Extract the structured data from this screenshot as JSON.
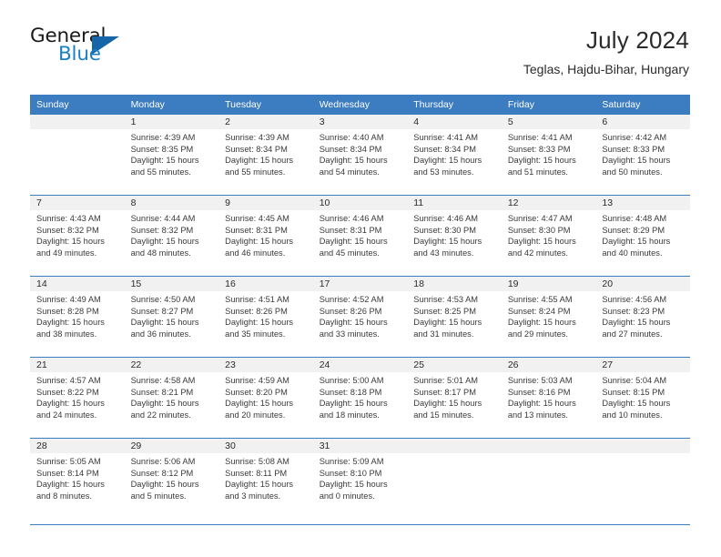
{
  "brand": {
    "name_part1": "General",
    "name_part2": "Blue",
    "accent_color": "#1c7fc4",
    "triangle_color": "#1565a8"
  },
  "header": {
    "title": "July 2024",
    "location": "Teglas, Hajdu-Bihar, Hungary"
  },
  "theme": {
    "header_bar_color": "#3c7cc0",
    "daynum_strip_color": "#f1f1f1",
    "text_color": "#3a3a3a"
  },
  "weekdays": [
    "Sunday",
    "Monday",
    "Tuesday",
    "Wednesday",
    "Thursday",
    "Friday",
    "Saturday"
  ],
  "weeks": [
    [
      {
        "day": "",
        "sunrise": "",
        "sunset": "",
        "daylight_1": "",
        "daylight_2": ""
      },
      {
        "day": "1",
        "sunrise": "Sunrise: 4:39 AM",
        "sunset": "Sunset: 8:35 PM",
        "daylight_1": "Daylight: 15 hours",
        "daylight_2": "and 55 minutes."
      },
      {
        "day": "2",
        "sunrise": "Sunrise: 4:39 AM",
        "sunset": "Sunset: 8:34 PM",
        "daylight_1": "Daylight: 15 hours",
        "daylight_2": "and 55 minutes."
      },
      {
        "day": "3",
        "sunrise": "Sunrise: 4:40 AM",
        "sunset": "Sunset: 8:34 PM",
        "daylight_1": "Daylight: 15 hours",
        "daylight_2": "and 54 minutes."
      },
      {
        "day": "4",
        "sunrise": "Sunrise: 4:41 AM",
        "sunset": "Sunset: 8:34 PM",
        "daylight_1": "Daylight: 15 hours",
        "daylight_2": "and 53 minutes."
      },
      {
        "day": "5",
        "sunrise": "Sunrise: 4:41 AM",
        "sunset": "Sunset: 8:33 PM",
        "daylight_1": "Daylight: 15 hours",
        "daylight_2": "and 51 minutes."
      },
      {
        "day": "6",
        "sunrise": "Sunrise: 4:42 AM",
        "sunset": "Sunset: 8:33 PM",
        "daylight_1": "Daylight: 15 hours",
        "daylight_2": "and 50 minutes."
      }
    ],
    [
      {
        "day": "7",
        "sunrise": "Sunrise: 4:43 AM",
        "sunset": "Sunset: 8:32 PM",
        "daylight_1": "Daylight: 15 hours",
        "daylight_2": "and 49 minutes."
      },
      {
        "day": "8",
        "sunrise": "Sunrise: 4:44 AM",
        "sunset": "Sunset: 8:32 PM",
        "daylight_1": "Daylight: 15 hours",
        "daylight_2": "and 48 minutes."
      },
      {
        "day": "9",
        "sunrise": "Sunrise: 4:45 AM",
        "sunset": "Sunset: 8:31 PM",
        "daylight_1": "Daylight: 15 hours",
        "daylight_2": "and 46 minutes."
      },
      {
        "day": "10",
        "sunrise": "Sunrise: 4:46 AM",
        "sunset": "Sunset: 8:31 PM",
        "daylight_1": "Daylight: 15 hours",
        "daylight_2": "and 45 minutes."
      },
      {
        "day": "11",
        "sunrise": "Sunrise: 4:46 AM",
        "sunset": "Sunset: 8:30 PM",
        "daylight_1": "Daylight: 15 hours",
        "daylight_2": "and 43 minutes."
      },
      {
        "day": "12",
        "sunrise": "Sunrise: 4:47 AM",
        "sunset": "Sunset: 8:30 PM",
        "daylight_1": "Daylight: 15 hours",
        "daylight_2": "and 42 minutes."
      },
      {
        "day": "13",
        "sunrise": "Sunrise: 4:48 AM",
        "sunset": "Sunset: 8:29 PM",
        "daylight_1": "Daylight: 15 hours",
        "daylight_2": "and 40 minutes."
      }
    ],
    [
      {
        "day": "14",
        "sunrise": "Sunrise: 4:49 AM",
        "sunset": "Sunset: 8:28 PM",
        "daylight_1": "Daylight: 15 hours",
        "daylight_2": "and 38 minutes."
      },
      {
        "day": "15",
        "sunrise": "Sunrise: 4:50 AM",
        "sunset": "Sunset: 8:27 PM",
        "daylight_1": "Daylight: 15 hours",
        "daylight_2": "and 36 minutes."
      },
      {
        "day": "16",
        "sunrise": "Sunrise: 4:51 AM",
        "sunset": "Sunset: 8:26 PM",
        "daylight_1": "Daylight: 15 hours",
        "daylight_2": "and 35 minutes."
      },
      {
        "day": "17",
        "sunrise": "Sunrise: 4:52 AM",
        "sunset": "Sunset: 8:26 PM",
        "daylight_1": "Daylight: 15 hours",
        "daylight_2": "and 33 minutes."
      },
      {
        "day": "18",
        "sunrise": "Sunrise: 4:53 AM",
        "sunset": "Sunset: 8:25 PM",
        "daylight_1": "Daylight: 15 hours",
        "daylight_2": "and 31 minutes."
      },
      {
        "day": "19",
        "sunrise": "Sunrise: 4:55 AM",
        "sunset": "Sunset: 8:24 PM",
        "daylight_1": "Daylight: 15 hours",
        "daylight_2": "and 29 minutes."
      },
      {
        "day": "20",
        "sunrise": "Sunrise: 4:56 AM",
        "sunset": "Sunset: 8:23 PM",
        "daylight_1": "Daylight: 15 hours",
        "daylight_2": "and 27 minutes."
      }
    ],
    [
      {
        "day": "21",
        "sunrise": "Sunrise: 4:57 AM",
        "sunset": "Sunset: 8:22 PM",
        "daylight_1": "Daylight: 15 hours",
        "daylight_2": "and 24 minutes."
      },
      {
        "day": "22",
        "sunrise": "Sunrise: 4:58 AM",
        "sunset": "Sunset: 8:21 PM",
        "daylight_1": "Daylight: 15 hours",
        "daylight_2": "and 22 minutes."
      },
      {
        "day": "23",
        "sunrise": "Sunrise: 4:59 AM",
        "sunset": "Sunset: 8:20 PM",
        "daylight_1": "Daylight: 15 hours",
        "daylight_2": "and 20 minutes."
      },
      {
        "day": "24",
        "sunrise": "Sunrise: 5:00 AM",
        "sunset": "Sunset: 8:18 PM",
        "daylight_1": "Daylight: 15 hours",
        "daylight_2": "and 18 minutes."
      },
      {
        "day": "25",
        "sunrise": "Sunrise: 5:01 AM",
        "sunset": "Sunset: 8:17 PM",
        "daylight_1": "Daylight: 15 hours",
        "daylight_2": "and 15 minutes."
      },
      {
        "day": "26",
        "sunrise": "Sunrise: 5:03 AM",
        "sunset": "Sunset: 8:16 PM",
        "daylight_1": "Daylight: 15 hours",
        "daylight_2": "and 13 minutes."
      },
      {
        "day": "27",
        "sunrise": "Sunrise: 5:04 AM",
        "sunset": "Sunset: 8:15 PM",
        "daylight_1": "Daylight: 15 hours",
        "daylight_2": "and 10 minutes."
      }
    ],
    [
      {
        "day": "28",
        "sunrise": "Sunrise: 5:05 AM",
        "sunset": "Sunset: 8:14 PM",
        "daylight_1": "Daylight: 15 hours",
        "daylight_2": "and 8 minutes."
      },
      {
        "day": "29",
        "sunrise": "Sunrise: 5:06 AM",
        "sunset": "Sunset: 8:12 PM",
        "daylight_1": "Daylight: 15 hours",
        "daylight_2": "and 5 minutes."
      },
      {
        "day": "30",
        "sunrise": "Sunrise: 5:08 AM",
        "sunset": "Sunset: 8:11 PM",
        "daylight_1": "Daylight: 15 hours",
        "daylight_2": "and 3 minutes."
      },
      {
        "day": "31",
        "sunrise": "Sunrise: 5:09 AM",
        "sunset": "Sunset: 8:10 PM",
        "daylight_1": "Daylight: 15 hours",
        "daylight_2": "and 0 minutes."
      },
      {
        "day": "",
        "sunrise": "",
        "sunset": "",
        "daylight_1": "",
        "daylight_2": ""
      },
      {
        "day": "",
        "sunrise": "",
        "sunset": "",
        "daylight_1": "",
        "daylight_2": ""
      },
      {
        "day": "",
        "sunrise": "",
        "sunset": "",
        "daylight_1": "",
        "daylight_2": ""
      }
    ]
  ]
}
